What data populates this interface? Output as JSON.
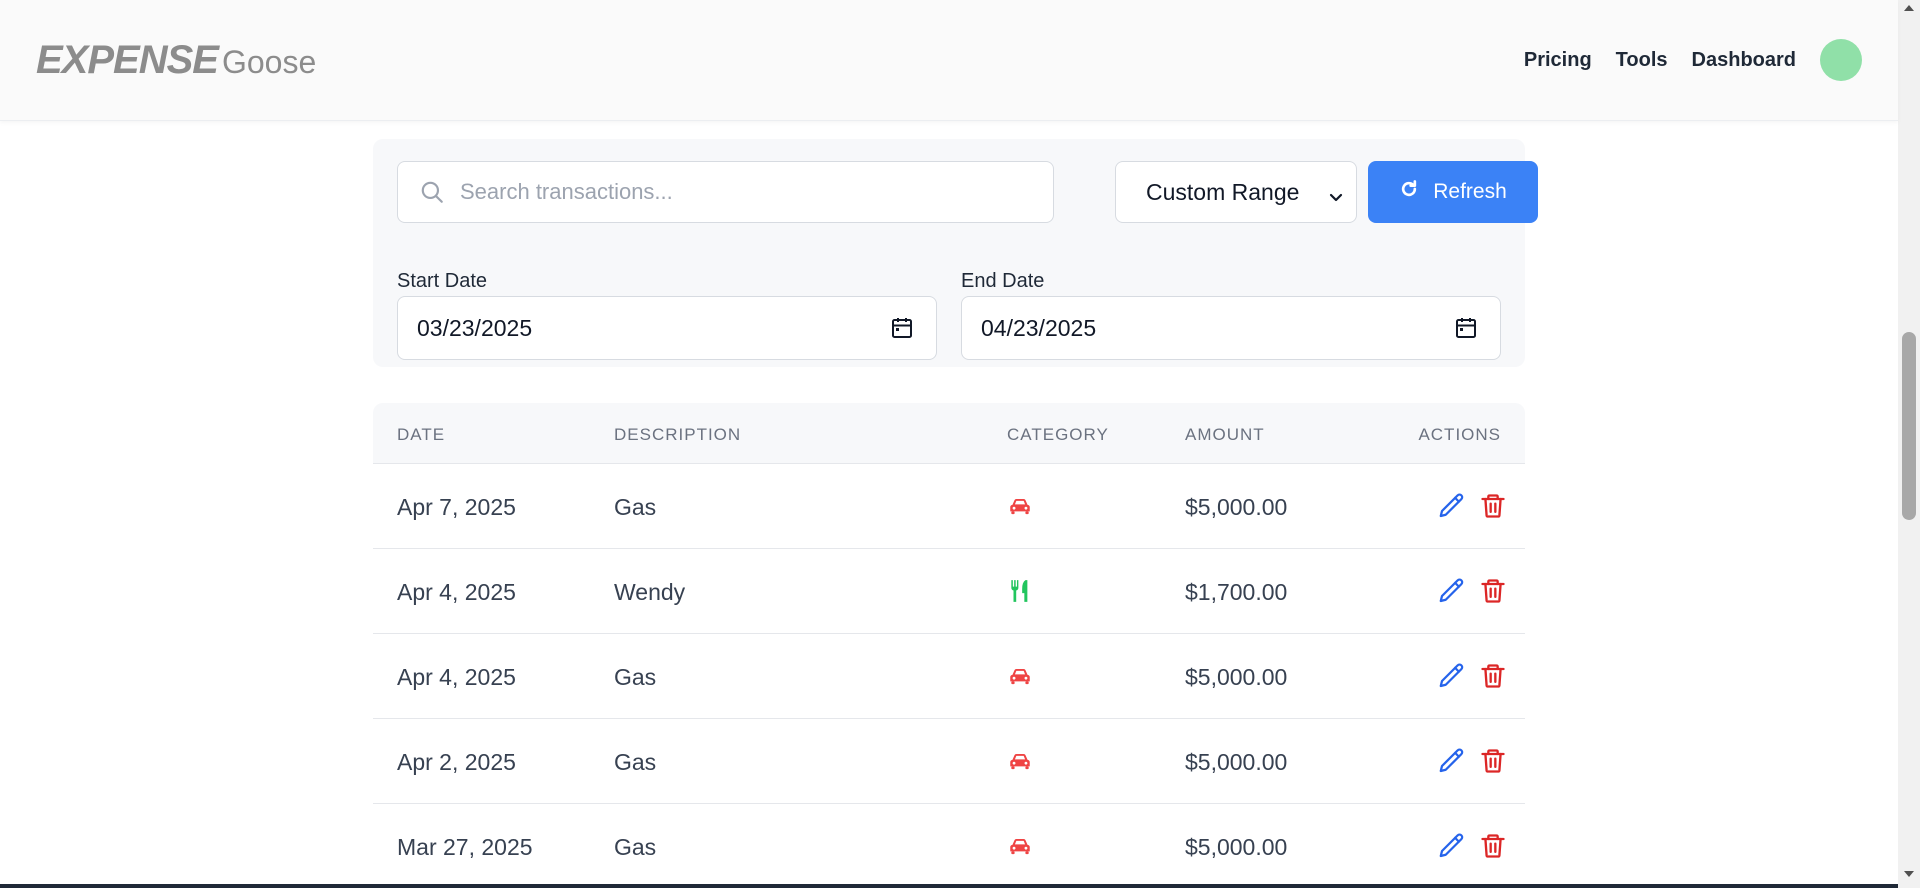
{
  "header": {
    "logo_main": "EXPENSE",
    "logo_sub": "Goose",
    "nav": [
      "Pricing",
      "Tools",
      "Dashboard"
    ]
  },
  "filters": {
    "search_placeholder": "Search transactions...",
    "range_value": "Custom Range",
    "refresh_label": "Refresh",
    "start_label": "Start Date",
    "start_value": "03/23/2025",
    "end_label": "End Date",
    "end_value": "04/23/2025"
  },
  "table": {
    "headers": [
      "DATE",
      "DESCRIPTION",
      "CATEGORY",
      "AMOUNT",
      "ACTIONS"
    ],
    "rows": [
      {
        "date": "Apr 7, 2025",
        "description": "Gas",
        "category_icon": "car-icon",
        "amount": "$5,000.00"
      },
      {
        "date": "Apr 4, 2025",
        "description": "Wendy",
        "category_icon": "utensils-icon",
        "amount": "$1,700.00"
      },
      {
        "date": "Apr 4, 2025",
        "description": "Gas",
        "category_icon": "car-icon",
        "amount": "$5,000.00"
      },
      {
        "date": "Apr 2, 2025",
        "description": "Gas",
        "category_icon": "car-icon",
        "amount": "$5,000.00"
      },
      {
        "date": "Mar 27, 2025",
        "description": "Gas",
        "category_icon": "car-icon",
        "amount": "$5,000.00"
      }
    ]
  },
  "colors": {
    "accent": "#3b82f6",
    "car": "#ef4444",
    "food": "#22c55e",
    "edit": "#2563eb",
    "delete": "#dc2626",
    "avatar": "#90e0a8"
  }
}
